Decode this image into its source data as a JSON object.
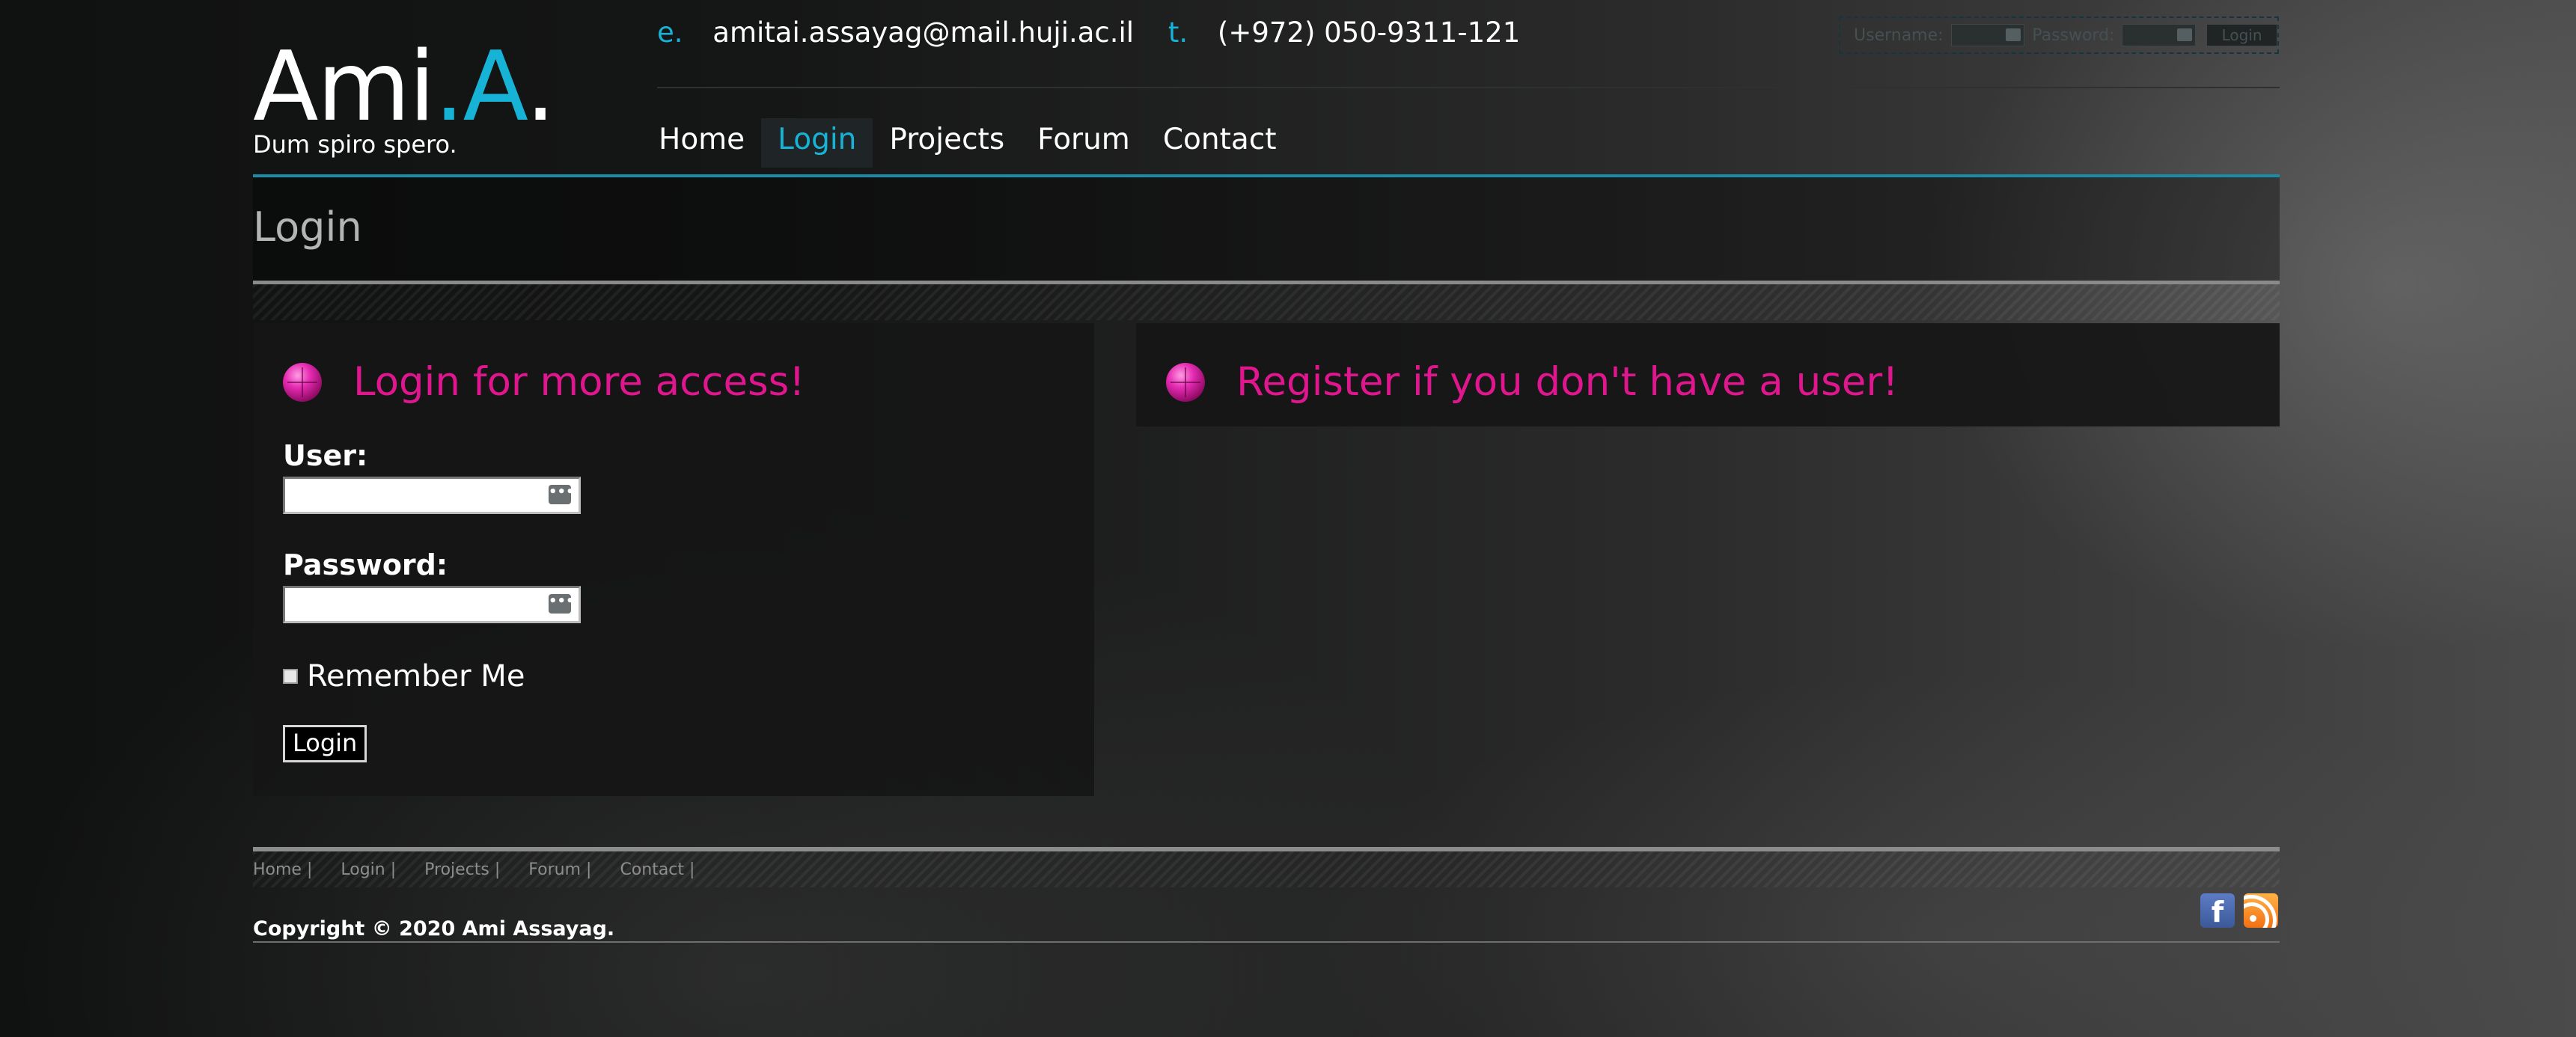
{
  "logo": {
    "part1": "Ami",
    "part2": ".A",
    "part3": ".",
    "tagline": "Dum spiro spero."
  },
  "contact": {
    "email_label": "e.",
    "email": "amitai.assayag@mail.huji.ac.il",
    "phone_label": "t.",
    "phone": "(+972) 050-9311-121"
  },
  "mini_login": {
    "username_label": "Username:",
    "password_label": "Password:",
    "button_label": "Login"
  },
  "nav": {
    "home": "Home",
    "login": "Login",
    "projects": "Projects",
    "forum": "Forum",
    "contact": "Contact",
    "active": "Login"
  },
  "page": {
    "title": "Login"
  },
  "login_panel": {
    "title": "Login for more access!",
    "user_label": "User:",
    "user_value": "",
    "password_label": "Password:",
    "password_value": "",
    "remember_label": "Remember Me",
    "remember_checked": false,
    "button_label": "Login"
  },
  "register_panel": {
    "title": "Register if you don't have a user!"
  },
  "footer": {
    "links": {
      "home": "Home |",
      "login": "Login |",
      "projects": "Projects |",
      "forum": "Forum |",
      "contact": "Contact |"
    },
    "copyright": "Copyright © 2020 Ami Assayag.",
    "social": [
      "facebook-icon",
      "rss-icon"
    ]
  },
  "colors": {
    "accent": "#17b3d6",
    "highlight": "#e0168f",
    "background": "#151616"
  }
}
